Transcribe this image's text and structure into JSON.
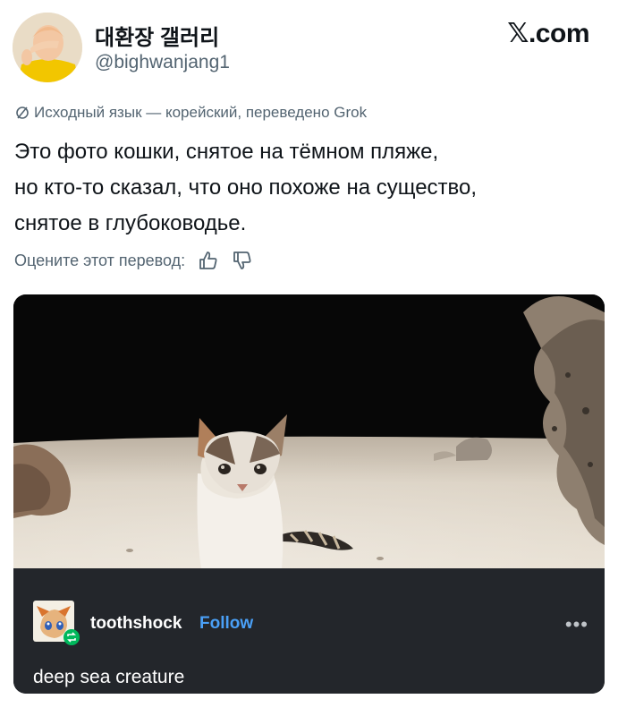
{
  "header": {
    "display_name": "대환장 갤러리",
    "handle": "@bighwanjang1",
    "site": ".com",
    "site_mark": "𝕏"
  },
  "post": {
    "translation_note": "Исходный язык — корейский, переведено Grok",
    "text_lines": [
      "Это фото кошки, снятое на тёмном пляже,",
      "но кто-то сказал, что оно похоже на существо,",
      "снятое в глубоководье."
    ],
    "rate_prompt": "Оцените этот перевод:"
  },
  "embed": {
    "username": "toothshock",
    "follow_label": "Follow",
    "more_label": "•••",
    "caption": "deep sea creature"
  },
  "icons": {
    "translate": "translate-icon",
    "thumbs_up": "thumbs-up-icon",
    "thumbs_down": "thumbs-down-icon",
    "more": "more-icon",
    "reblog_badge": "reblog-badge-icon"
  },
  "colors": {
    "text_primary": "#0f1419",
    "text_secondary": "#536471",
    "card_bg": "#23262b",
    "follow_blue": "#4aa0f7",
    "badge_green": "#00b85c"
  }
}
